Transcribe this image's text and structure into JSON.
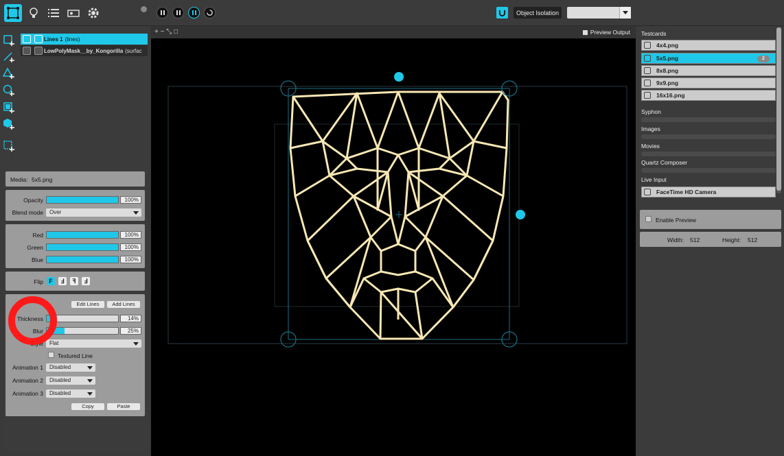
{
  "toolbar": {
    "tools": [
      "surface-tool-icon",
      "lightbulb-icon",
      "list-icon",
      "projector-icon",
      "gear-icon"
    ],
    "object_isolation_label": "Object Isolation",
    "object_select_value": ""
  },
  "layers": [
    {
      "name": "Lines 1",
      "type": "(lines)",
      "selected": true
    },
    {
      "name": "LowPolyMask__by_Kongorilla",
      "type": "(surfac",
      "selected": false
    }
  ],
  "props": {
    "media_label": "Media:",
    "media_value": "5x5.png",
    "opacity_label": "Opacity",
    "opacity_value": "100%",
    "blend_label": "Blend mode",
    "blend_value": "Over",
    "red_label": "Red",
    "red_value": "100%",
    "green_label": "Green",
    "green_value": "100%",
    "blue_label": "Blue",
    "blue_value": "100%",
    "flip_label": "Flip",
    "flip_buttons": [
      "F",
      "Ⅎ",
      "ꟻ",
      "Ⅎ"
    ],
    "edit_lines_label": "Edit Lines",
    "add_lines_label": "Add Lines",
    "thickness_label": "Thickness",
    "thickness_value": "14%",
    "blur_label": "Blur",
    "blur_value": "25%",
    "style_label": "Style",
    "style_value": "Flat",
    "textured_label": "Textured Line",
    "anim1_label": "Animation 1",
    "anim1_value": "Disabled",
    "anim2_label": "Animation 2",
    "anim2_value": "Disabled",
    "anim3_label": "Animation 3",
    "anim3_value": "Disabled",
    "copy_label": "Copy",
    "paste_label": "Paste"
  },
  "canvas": {
    "controls": "+ − ⤡ □",
    "preview_output_label": "Preview Output"
  },
  "right": {
    "testcards_title": "Testcards",
    "testcards": [
      "4x4.png",
      "5x5.png",
      "8x8.png",
      "9x9.png",
      "16x16.png"
    ],
    "selected_badge": "2",
    "syphon_title": "Syphon",
    "images_title": "Images",
    "movies_title": "Movies",
    "quartz_title": "Quartz Composer",
    "live_input_title": "Live Input",
    "live_input_device": "FaceTime HD Camera",
    "enable_preview_label": "Enable Preview",
    "width_label": "Width:",
    "width_value": "512",
    "height_label": "Height:",
    "height_value": "512"
  },
  "colors": {
    "accent": "#1fc8e8",
    "line_color": "#f7e7b4",
    "highlight_circle": "#ff1a1a"
  }
}
